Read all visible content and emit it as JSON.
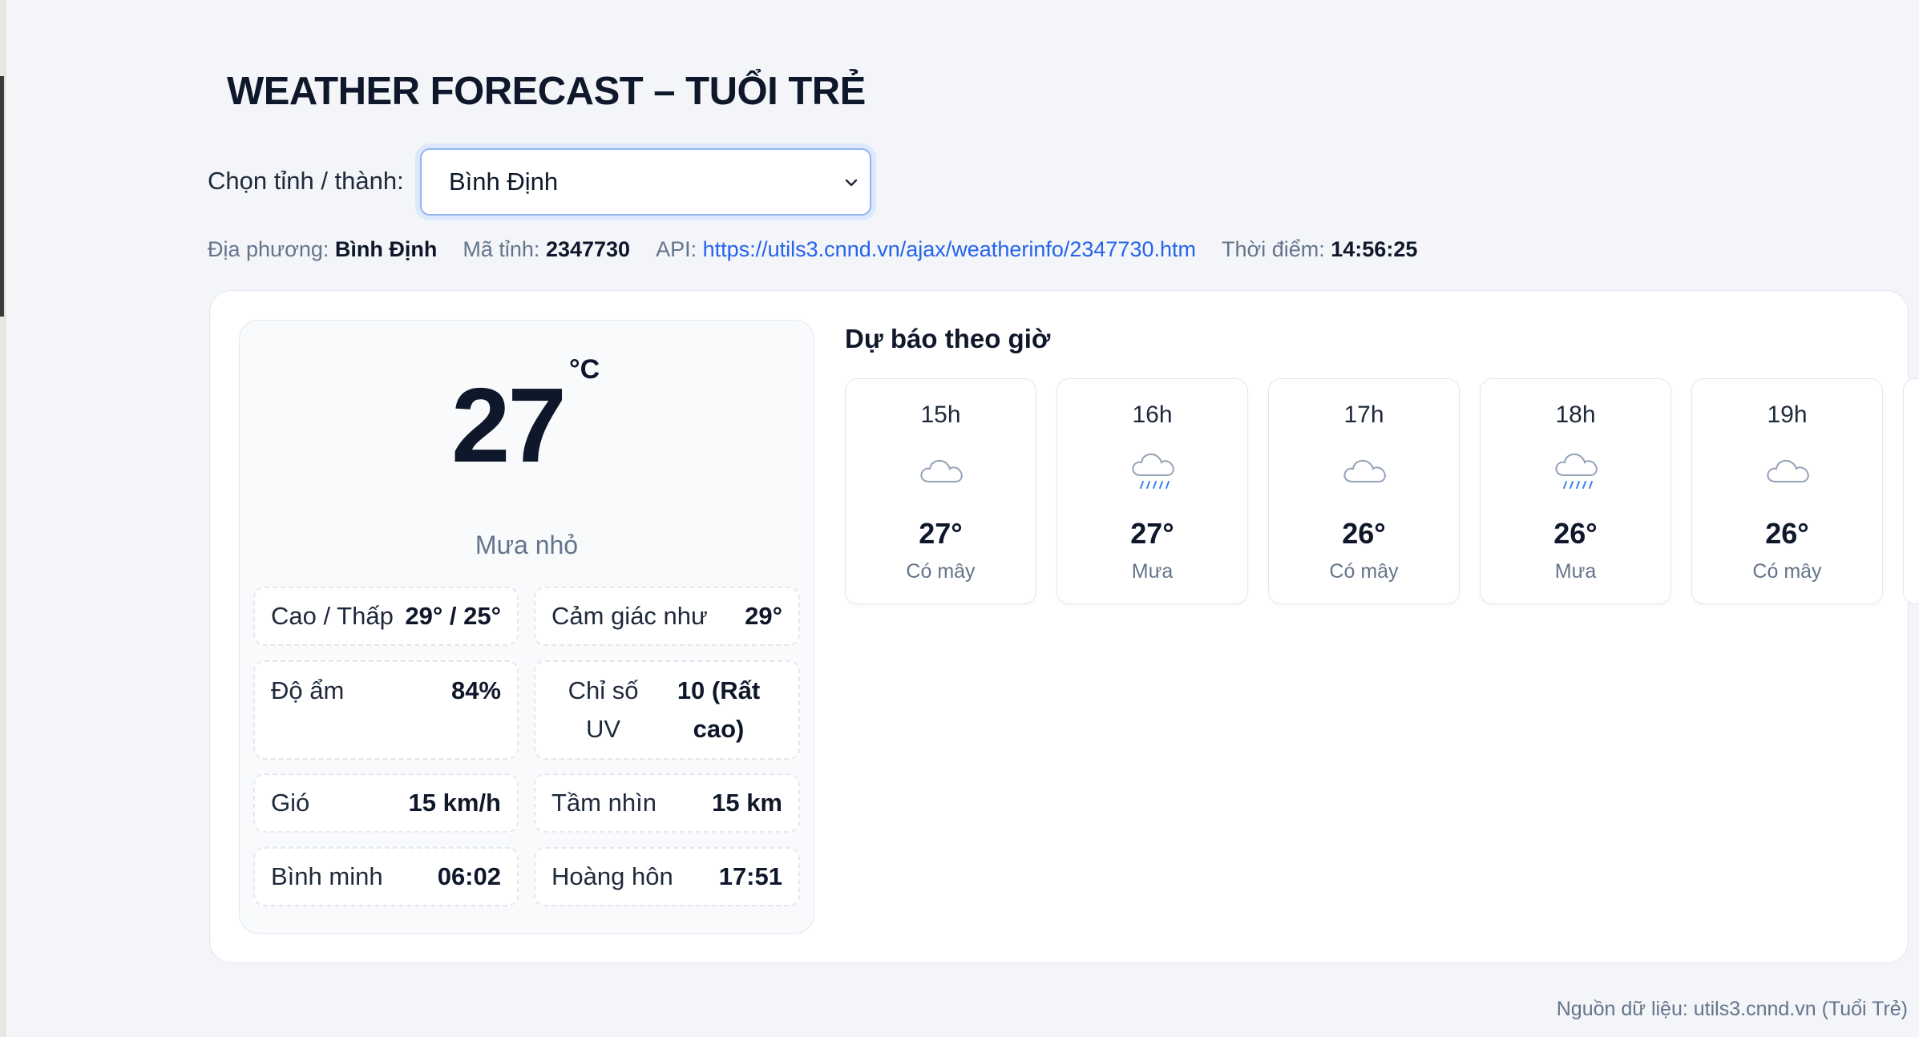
{
  "title": "WEATHER FORECAST – TUỔI TRẺ",
  "province": {
    "label": "Chọn tỉnh / thành:",
    "selected": "Bình Định"
  },
  "meta": {
    "location_label": "Địa phương:",
    "location_value": "Bình Định",
    "code_label": "Mã tỉnh:",
    "code_value": "2347730",
    "api_label": "API:",
    "api_url": "https://utils3.cnnd.vn/ajax/weatherinfo/2347730.htm",
    "time_label": "Thời điểm:",
    "time_value": "14:56:25"
  },
  "current": {
    "temp": "27",
    "unit": "°C",
    "condition": "Mưa nhỏ",
    "stats": [
      {
        "label": "Cao / Thấp",
        "value": "29° / 25°"
      },
      {
        "label": "Cảm giác như",
        "value": "29°"
      },
      {
        "label": "Độ ẩm",
        "value": "84%"
      },
      {
        "label": "Chỉ số UV",
        "value": "10 (Rất cao)"
      },
      {
        "label": "Gió",
        "value": "15 km/h"
      },
      {
        "label": "Tầm nhìn",
        "value": "15 km"
      },
      {
        "label": "Bình minh",
        "value": "06:02"
      },
      {
        "label": "Hoàng hôn",
        "value": "17:51"
      }
    ]
  },
  "hourly": {
    "title": "Dự báo theo giờ",
    "items": [
      {
        "hour": "15h",
        "temp": "27°",
        "desc": "Có mây",
        "icon": "cloud-icon"
      },
      {
        "hour": "16h",
        "temp": "27°",
        "desc": "Mưa",
        "icon": "rain-icon"
      },
      {
        "hour": "17h",
        "temp": "26°",
        "desc": "Có mây",
        "icon": "cloud-icon"
      },
      {
        "hour": "18h",
        "temp": "26°",
        "desc": "Mưa",
        "icon": "rain-icon"
      },
      {
        "hour": "19h",
        "temp": "26°",
        "desc": "Có mây",
        "icon": "cloud-icon"
      }
    ]
  },
  "footer": "Nguồn dữ liệu: utils3.cnnd.vn (Tuổi Trẻ)",
  "colors": {
    "accent": "#2563eb",
    "muted": "#64748b",
    "rain": "#3b82f6",
    "background": "#f3f5f9"
  }
}
